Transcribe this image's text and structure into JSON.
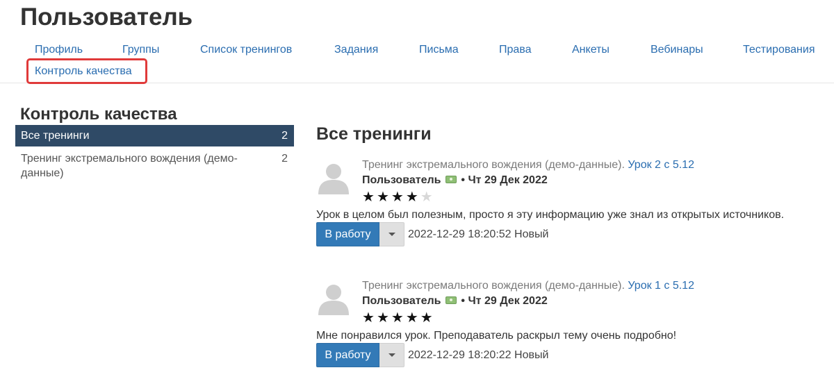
{
  "header": {
    "title": "Пользователь"
  },
  "tabs": [
    {
      "label": "Профиль"
    },
    {
      "label": "Группы"
    },
    {
      "label": "Список тренингов"
    },
    {
      "label": "Задания"
    },
    {
      "label": "Письма"
    },
    {
      "label": "Права"
    },
    {
      "label": "Анкеты"
    },
    {
      "label": "Вебинары"
    },
    {
      "label": "Тестирования"
    },
    {
      "label": "Контроль качества"
    }
  ],
  "highlight_color": "#e03a3a",
  "sidebar": {
    "title": "Контроль качества",
    "items": [
      {
        "label": "Все тренинги",
        "count": "2",
        "active": true
      },
      {
        "label": "Тренинг экстремального вождения (демо-данные)",
        "count": "2",
        "active": false
      }
    ]
  },
  "main": {
    "title": "Все тренинги",
    "reviews": [
      {
        "training": "Тренинг экстремального вождения (демо-данные).",
        "lesson": "Урок 2 с 5.12",
        "author": "Пользователь",
        "separator": "•",
        "date": "Чт 29 Дек 2022",
        "rating": 4,
        "rating_max": 5,
        "comment": "Урок в целом был полезным, просто я эту информацию уже знал из открытых источников.",
        "button": "В работу",
        "timestamp": "2022-12-29 18:20:52",
        "status": "Новый"
      },
      {
        "training": "Тренинг экстремального вождения (демо-данные).",
        "lesson": "Урок 1 с 5.12",
        "author": "Пользователь",
        "separator": "•",
        "date": "Чт 29 Дек 2022",
        "rating": 5,
        "rating_max": 5,
        "comment": "Мне понравился урок. Преподаватель раскрыл тему очень подробно!",
        "button": "В работу",
        "timestamp": "2022-12-29 18:20:22",
        "status": "Новый"
      }
    ]
  },
  "colors": {
    "accent": "#337ab7",
    "link": "#2a6db0",
    "sidebar_active": "#2f4a66"
  },
  "icons": {
    "avatar": "user-avatar-icon",
    "money": "money-icon",
    "star": "star-icon",
    "caret": "caret-down-icon"
  }
}
